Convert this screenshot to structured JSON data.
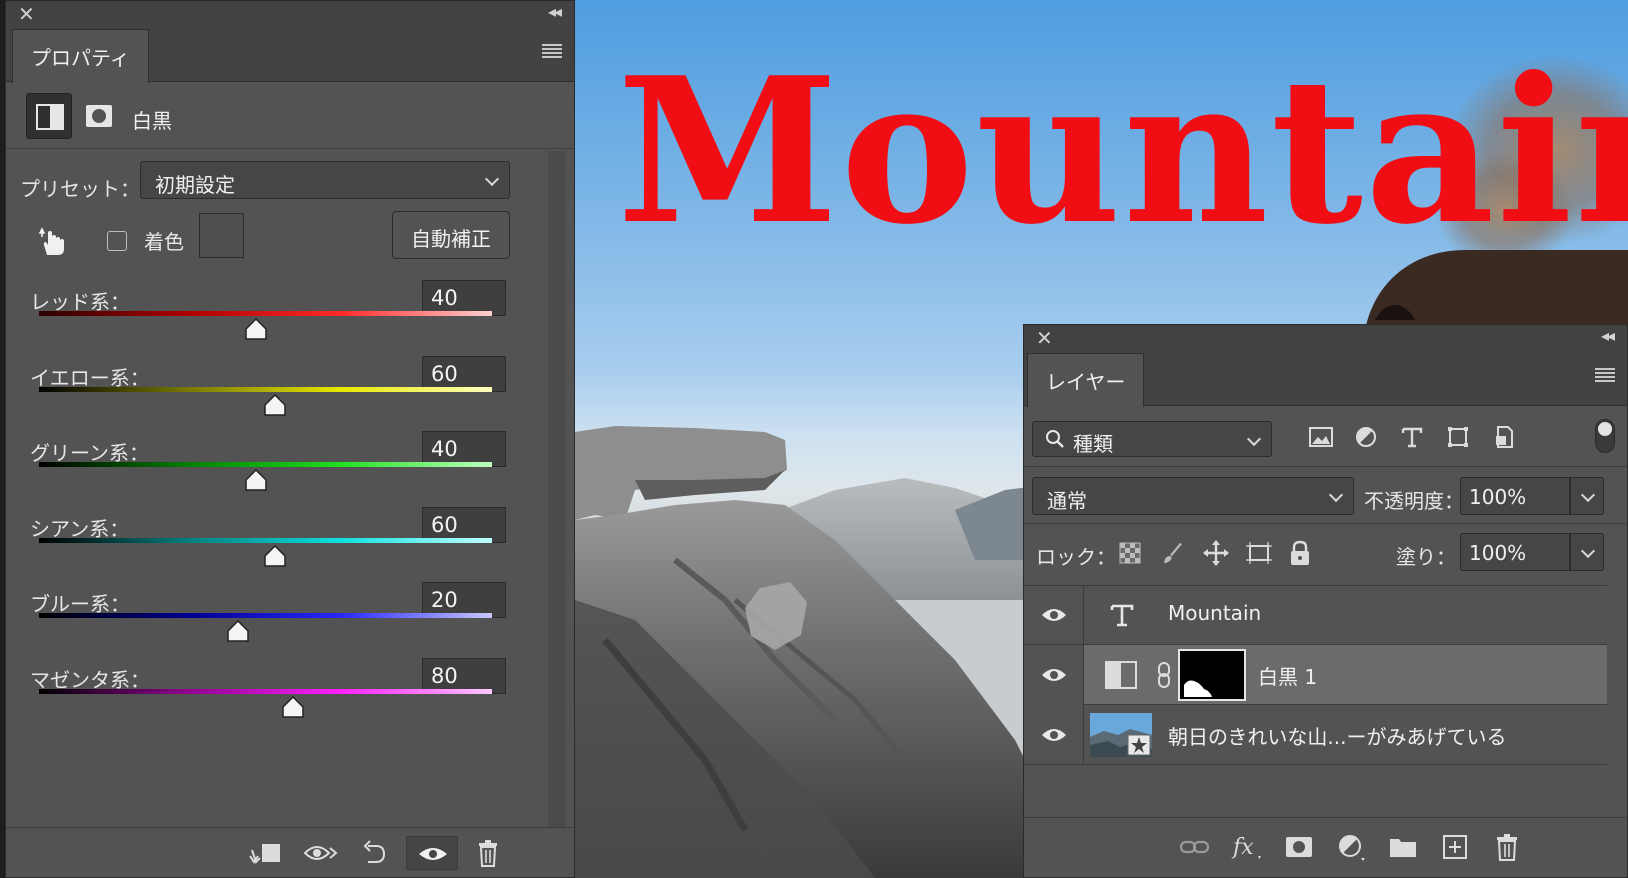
{
  "canvas": {
    "title_text": "Mountain",
    "title_color": "#f00d14"
  },
  "properties": {
    "tab_label": "プロパティ",
    "adjustment_label": "白黒",
    "preset_label": "プリセット：",
    "preset_value": "初期設定",
    "tint_label": "着色",
    "auto_button": "自動補正",
    "sliders": [
      {
        "label": "レッド系：",
        "value": "40",
        "gradient": [
          "#2a0000",
          "#b00000",
          "#ff2a2a",
          "#ffd0d0"
        ]
      },
      {
        "label": "イエロー系：",
        "value": "60",
        "gradient": [
          "#000000",
          "#7a7a00",
          "#e8e800",
          "#ffffc0"
        ]
      },
      {
        "label": "グリーン系：",
        "value": "40",
        "gradient": [
          "#000000",
          "#008000",
          "#20e020",
          "#c0ffc0"
        ]
      },
      {
        "label": "シアン系：",
        "value": "60",
        "gradient": [
          "#000000",
          "#008080",
          "#10e0e0",
          "#c0ffff"
        ]
      },
      {
        "label": "ブルー系：",
        "value": "20",
        "gradient": [
          "#000000",
          "#000090",
          "#2828ff",
          "#c8c8ff"
        ]
      },
      {
        "label": "マゼンタ系：",
        "value": "80",
        "gradient": [
          "#000000",
          "#900090",
          "#ff20ff",
          "#ffc8ff"
        ]
      }
    ],
    "slider_range": [
      -200,
      300
    ]
  },
  "layers": {
    "tab_label": "レイヤー",
    "filter_value": "種類",
    "blend_mode": "通常",
    "opacity_label": "不透明度：",
    "opacity_value": "100%",
    "lock_label": "ロック：",
    "fill_label": "塗り：",
    "fill_value": "100%",
    "items": [
      {
        "name": "Mountain",
        "type": "text",
        "selected": false
      },
      {
        "name": "白黒 1",
        "type": "adjustment",
        "selected": true
      },
      {
        "name": "朝日のきれいな山...ーがみあげている",
        "type": "smart-object",
        "selected": false
      }
    ]
  },
  "colors": {
    "panel_bg": "#535353",
    "panel_header": "#424242",
    "accent_red": "#f00d14"
  }
}
